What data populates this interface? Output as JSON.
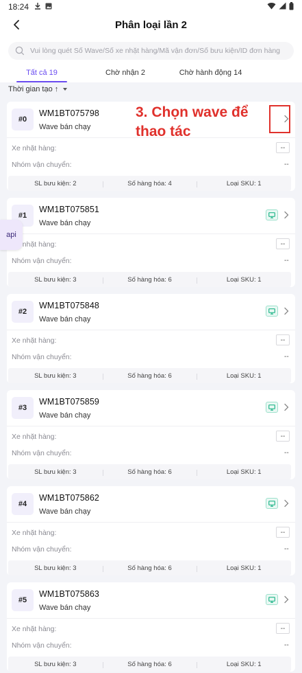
{
  "status_bar": {
    "time": "18:24"
  },
  "header": {
    "title": "Phân loại lần 2"
  },
  "search": {
    "placeholder": "Vui lòng quét Số Wave/Số xe nhặt hàng/Mã vận đơn/Số bưu kiện/ID đơn hàng"
  },
  "tabs": [
    {
      "label": "Tất cả 19",
      "active": true
    },
    {
      "label": "Chờ nhận 2",
      "active": false
    },
    {
      "label": "Chờ hành động 14",
      "active": false
    }
  ],
  "filter": {
    "label": "Thời gian tạo ↑"
  },
  "labels": {
    "picking_cart": "Xe nhặt hàng:",
    "shipping_group": "Nhóm vận chuyển:",
    "empty_value": "--",
    "parcels_prefix": "SL bưu kiện:",
    "goods_prefix": "Số hàng hóa:",
    "sku_prefix": "Loại SKU:"
  },
  "cards": [
    {
      "index": "#0",
      "code": "WM1BT075798",
      "type": "Wave bán chạy",
      "parcels": "2",
      "goods": "4",
      "sku": "1",
      "has_monitor": false
    },
    {
      "index": "#1",
      "code": "WM1BT075851",
      "type": "Wave bán chạy",
      "parcels": "3",
      "goods": "6",
      "sku": "1",
      "has_monitor": true
    },
    {
      "index": "#2",
      "code": "WM1BT075848",
      "type": "Wave bán chạy",
      "parcels": "3",
      "goods": "6",
      "sku": "1",
      "has_monitor": true
    },
    {
      "index": "#3",
      "code": "WM1BT075859",
      "type": "Wave bán chạy",
      "parcels": "3",
      "goods": "6",
      "sku": "1",
      "has_monitor": true
    },
    {
      "index": "#4",
      "code": "WM1BT075862",
      "type": "Wave bán chạy",
      "parcels": "3",
      "goods": "6",
      "sku": "1",
      "has_monitor": true
    },
    {
      "index": "#5",
      "code": "WM1BT075863",
      "type": "Wave bán chạy",
      "parcels": "3",
      "goods": "6",
      "sku": "1",
      "has_monitor": true
    }
  ],
  "annotation": {
    "text": "3. Chọn wave để\nthao tác",
    "color": "#e0312c"
  },
  "floating": {
    "api_label": "api"
  },
  "colors": {
    "accent": "#6a4cf0",
    "monitor": "#22b58a"
  }
}
